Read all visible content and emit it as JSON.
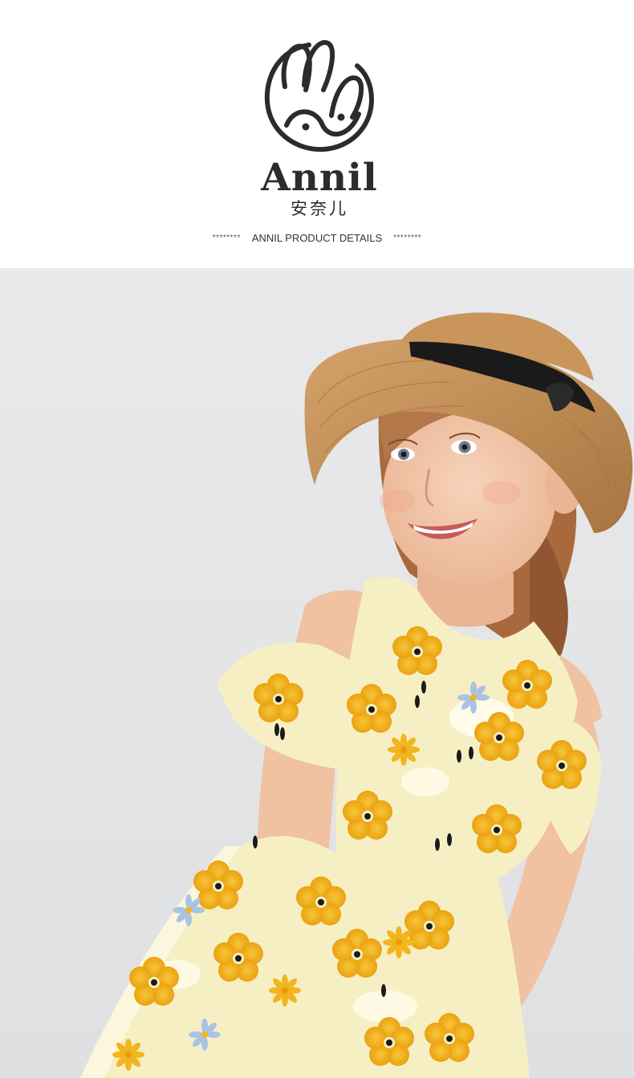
{
  "brand": {
    "name": "Annil",
    "name_cn": "安奈儿",
    "logo_icon": "rabbit-logo-icon"
  },
  "details": {
    "left_stars": "********",
    "label": "ANNIL PRODUCT DETAILS",
    "right_stars": "********"
  },
  "photo": {
    "subject": "product-photo-girl-in-yellow-floral-dress",
    "colors": {
      "background": "#e8e8ea",
      "dress_base": "#f7efc4",
      "flower_yellow": "#f2b51d",
      "flower_blue": "#a9c3e3",
      "hat": "#c9955a",
      "hat_band": "#1a1a1a",
      "hair": "#a86a3c",
      "skin": "#f2c6a8"
    }
  }
}
